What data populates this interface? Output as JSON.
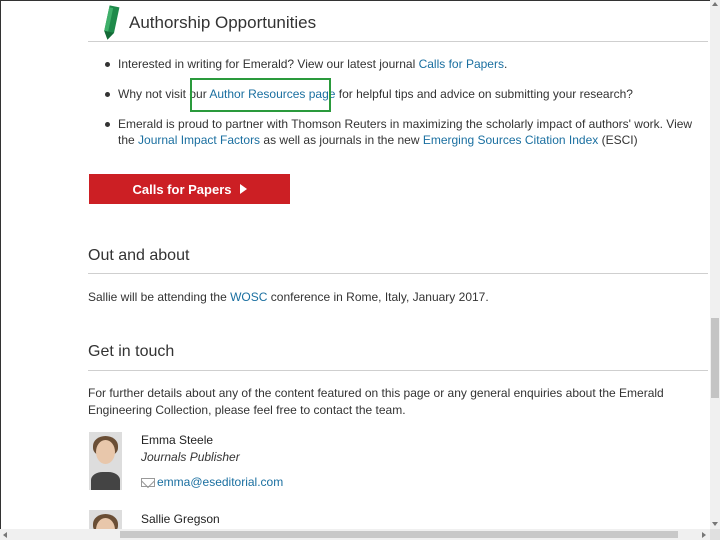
{
  "authorship": {
    "title": "Authorship Opportunities",
    "bullet1_pre": "Interested in writing for Emerald? View our latest journal ",
    "bullet1_link": "Calls for Papers",
    "bullet1_post": ".",
    "bullet2_pre": "Why not visit our ",
    "bullet2_link": "Author Resources page",
    "bullet2_post": " for helpful tips and advice on submitting your research?",
    "bullet3_pre": "Emerald is proud to partner with Thomson Reuters in maximizing the scholarly impact of authors' work. View the ",
    "bullet3_link1": "Journal Impact Factors",
    "bullet3_mid": " as well as journals in the new ",
    "bullet3_link2": "Emerging Sources Citation Index",
    "bullet3_post": " (ESCI)",
    "button_label": "Calls for Papers"
  },
  "out_and_about": {
    "heading": "Out and about",
    "text_pre": "Sallie will be attending the ",
    "text_link": "WOSC",
    "text_post": " conference in Rome, Italy, January 2017."
  },
  "get_in_touch": {
    "heading": "Get in touch",
    "text": "For further details about any of the content featured on this page or any general enquiries about the Emerald Engineering Collection, please feel free to contact the team."
  },
  "contacts": [
    {
      "name": "Emma Steele",
      "role": "Journals Publisher",
      "email": "emma@eseditorial.com"
    },
    {
      "name": "Sallie Gregson"
    }
  ],
  "colors": {
    "accent_red": "#cc1f24",
    "link_blue": "#1a6fa0",
    "pencil_green": "#1e8a4a",
    "highlight_green": "#2a9a3c"
  }
}
